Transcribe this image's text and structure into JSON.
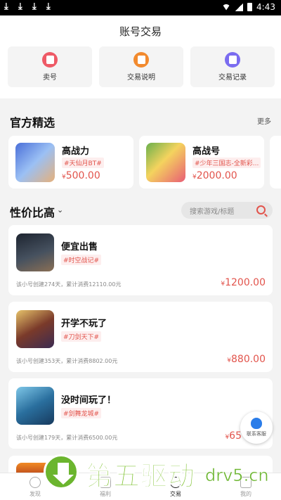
{
  "status_bar": {
    "time": "4:43",
    "download_icons": [
      "download-icon",
      "download-icon",
      "download-icon",
      "download-icon"
    ]
  },
  "header": {
    "title": "账号交易"
  },
  "entries": [
    {
      "label": "卖号",
      "icon": "sell-icon",
      "color": "#ee5a66"
    },
    {
      "label": "交易说明",
      "icon": "guide-icon",
      "color": "#f28a2e"
    },
    {
      "label": "交易记录",
      "icon": "record-icon",
      "color": "#7b6cf0"
    }
  ],
  "recommended": {
    "title": "官方精选",
    "more": "更多",
    "cards": [
      {
        "name": "高战力",
        "tag": "#天仙月BT#",
        "price_symbol": "¥",
        "price": "500.00"
      },
      {
        "name": "高战号",
        "tag": "#少年三国志-全新彩...",
        "price_symbol": "¥",
        "price": "2000.00"
      }
    ]
  },
  "listing": {
    "sort_label": "性价比高",
    "sort_caret": "⌄",
    "search_placeholder": "搜索游戏/标题",
    "items": [
      {
        "name": "便宜出售",
        "tag": "#时空战记#",
        "meta": "该小号创建274天，累计消费12110.00元",
        "price_symbol": "¥",
        "price": "1200.00"
      },
      {
        "name": "开学不玩了",
        "tag": "#刀剑天下#",
        "meta": "该小号创建353天，累计消费8802.00元",
        "price_symbol": "¥",
        "price": "880.00"
      },
      {
        "name": "没时间玩了！",
        "tag": "#剑舞龙城#",
        "meta": "该小号创建179天，累计消费6500.00元",
        "price_symbol": "¥",
        "price": "65"
      }
    ]
  },
  "contact_button": {
    "label": "联系客服"
  },
  "tabbar": {
    "tabs": [
      {
        "label": "发现",
        "icon": "compass-icon",
        "active": false
      },
      {
        "label": "福利",
        "icon": "gift-icon",
        "active": false
      },
      {
        "label": "交易",
        "icon": "trade-icon",
        "active": true
      },
      {
        "label": "我的",
        "icon": "profile-icon",
        "active": false
      }
    ]
  },
  "watermark": {
    "text": "第五驱动",
    "domain": "drv5.cn"
  },
  "colors": {
    "accent": "#e2544c",
    "tag_bg": "#fdeeee",
    "background": "#f3f3f3"
  }
}
